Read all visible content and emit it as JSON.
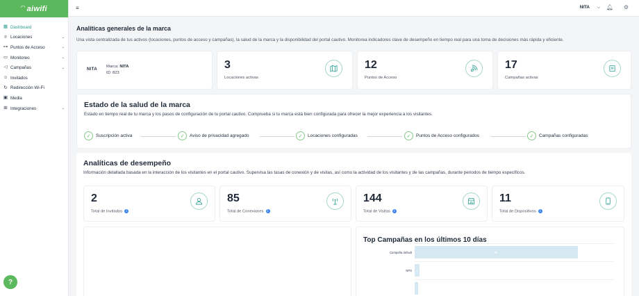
{
  "app": {
    "logo": "aiwifi"
  },
  "sidebar": {
    "items": [
      {
        "label": "Dashboard",
        "icon": "dashboard-icon",
        "chevron": false,
        "active": true
      },
      {
        "label": "Locaciones",
        "icon": "location-pin-icon",
        "chevron": true,
        "active": false
      },
      {
        "label": "Puntos de Acceso",
        "icon": "access-point-icon",
        "chevron": true,
        "active": false
      },
      {
        "label": "Monitoreo",
        "icon": "monitor-icon",
        "chevron": true,
        "active": false
      },
      {
        "label": "Campañas",
        "icon": "megaphone-icon",
        "chevron": true,
        "active": false
      },
      {
        "label": "Invitados",
        "icon": "users-icon",
        "chevron": false,
        "active": false
      },
      {
        "label": "Redirección Wi-Fi",
        "icon": "redirect-icon",
        "chevron": false,
        "active": false
      },
      {
        "label": "Media",
        "icon": "image-icon",
        "chevron": false,
        "active": false
      },
      {
        "label": "Integraciones",
        "icon": "integrations-icon",
        "chevron": true,
        "active": false
      }
    ],
    "help_label": "?"
  },
  "topbar": {
    "brand": "NITA"
  },
  "page": {
    "title": "Analíticas generales de la marca",
    "description": "Una vista centralizada de tus activos (locaciones, puntos de acceso y campañas), la salud de la marca y la disponibilidad del portal cautivo. Monitorea indicadores clave de desempeño en tiempo real para una toma de decisiones más rápida y eficiente."
  },
  "brand_card": {
    "logo_text": "NITA",
    "brand_label": "Marca:",
    "brand_name": "NITA",
    "id_text": "ID: 823"
  },
  "summary_stats": [
    {
      "value": "3",
      "label": "Locaciones activas",
      "icon": "map-icon"
    },
    {
      "value": "12",
      "label": "Puntos de Acceso",
      "icon": "wifi-router-icon"
    },
    {
      "value": "17",
      "label": "Campañas activas",
      "icon": "campaign-icon"
    }
  ],
  "health": {
    "title": "Estado de la salud de la marca",
    "description": "Estado en tiempo real de tu marca y los pasos de configuración de tu portal cautivo. Comprueba si tu marca está bien configurada para ofrecer la mejor experiencia a los visitantes.",
    "steps": [
      "Suscripción activa",
      "Aviso de privacidad agregado",
      "Locaciones configuradas",
      "Puntos de Acceso configurados",
      "Campañas configuradas"
    ]
  },
  "performance": {
    "title": "Analíticas de desempeño",
    "description": "Información detallada basada en la interacción de los visitantes en el portal cautivo. Supervisa las tasas de conexión y de visitas, así como la actividad de los visitantes y de las campañas, durante periodos de tiempo específicos.",
    "stats": [
      {
        "value": "2",
        "label": "Total de Invitados",
        "icon": "user-icon"
      },
      {
        "value": "85",
        "label": "Total de Conexiones",
        "icon": "antenna-icon"
      },
      {
        "value": "144",
        "label": "Total de Visitas",
        "icon": "storefront-icon"
      },
      {
        "value": "11",
        "label": "Total de Dispositivos",
        "icon": "mobile-icon"
      }
    ]
  },
  "colors": {
    "accent": "#5cb85c",
    "teal": "#2a9d8f",
    "info": "#3b82f6"
  },
  "chart_data": {
    "type": "bar",
    "orientation": "horizontal",
    "title": "Top Campañas en los últimos 10 días",
    "categories": [
      "Campaña default",
      "NPS",
      ""
    ],
    "values": [
      98,
      3,
      2
    ],
    "data_labels": [
      "98",
      "3",
      ""
    ],
    "xlim": [
      0,
      120
    ]
  }
}
